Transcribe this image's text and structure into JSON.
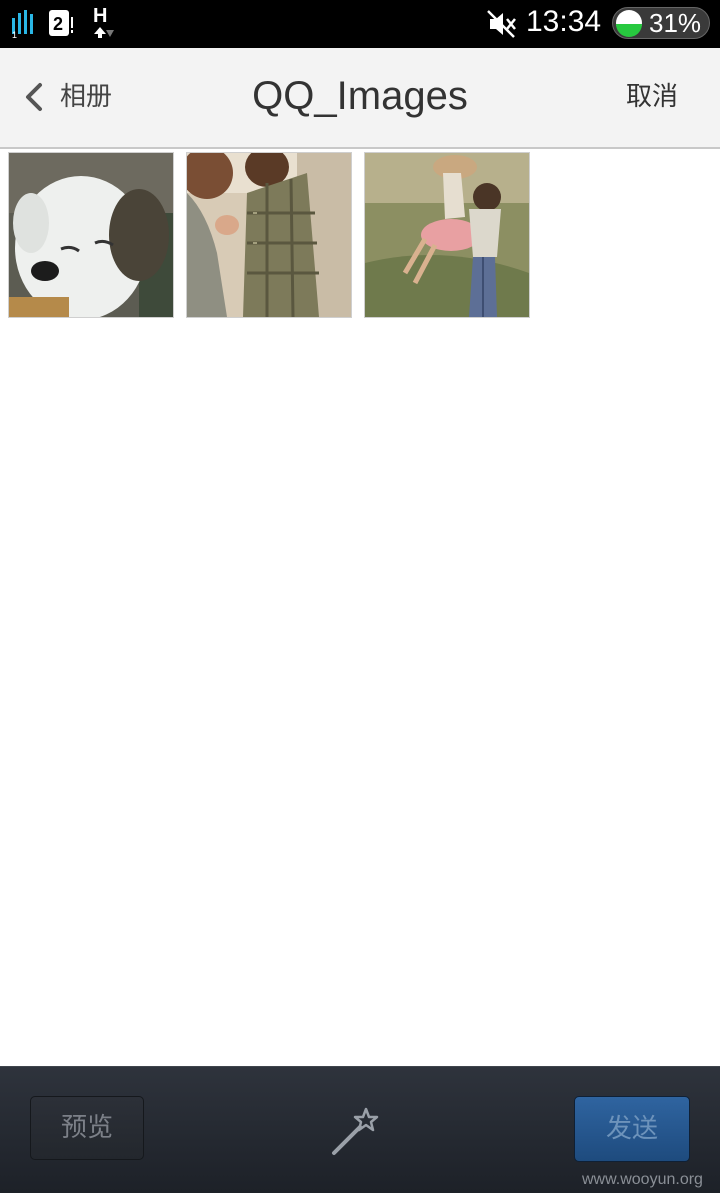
{
  "status_bar": {
    "sim_slot": "2",
    "network_type": "H",
    "time": "13:34",
    "battery": "31%",
    "icons": [
      "signal-icon",
      "sim-icon",
      "network-h-icon",
      "mute-icon",
      "battery-icon"
    ]
  },
  "header": {
    "back_label": "相册",
    "title": "QQ_Images",
    "cancel_label": "取消"
  },
  "photos": [
    {
      "name": "photo-puppy"
    },
    {
      "name": "photo-couple-kiss"
    },
    {
      "name": "photo-couple-hug"
    }
  ],
  "bottom_bar": {
    "preview_label": "预览",
    "send_label": "发送",
    "tool_icon": "magic-wand-icon"
  },
  "watermark": "www.wooyun.org",
  "colors": {
    "header_bg": "#f3f3f3",
    "bottom_bar_bg": "#23272e",
    "send_button_bg": "#2a5a92",
    "battery_green": "#27c93f"
  }
}
